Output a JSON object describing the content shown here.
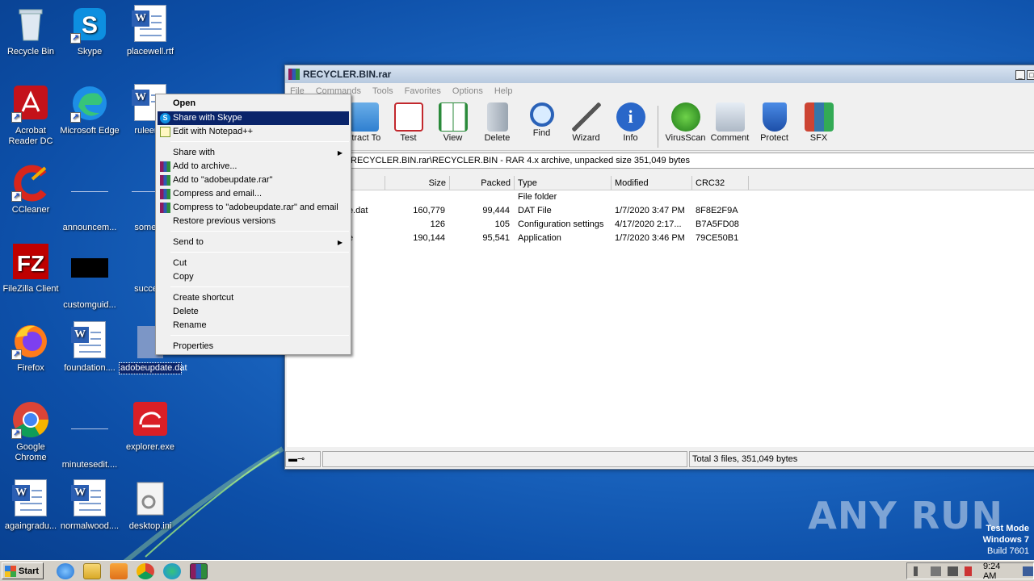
{
  "desktop": {
    "icons": [
      {
        "label": "Recycle Bin",
        "icon": "recycle-bin-icon"
      },
      {
        "label": "Skype",
        "icon": "skype-icon"
      },
      {
        "label": "placewell.rtf",
        "icon": "word-doc-icon"
      },
      {
        "label": "Acrobat Reader DC",
        "icon": "acrobat-icon"
      },
      {
        "label": "Microsoft Edge",
        "icon": "edge-icon"
      },
      {
        "label": "ruleengi",
        "icon": "word-doc-icon"
      },
      {
        "label": "CCleaner",
        "icon": "ccleaner-icon"
      },
      {
        "label": "announcem...",
        "icon": "blank-file-icon"
      },
      {
        "label": "someon",
        "icon": "blank-file-icon"
      },
      {
        "label": "FileZilla Client",
        "icon": "filezilla-icon"
      },
      {
        "label": "customguid...",
        "icon": "black-file-icon"
      },
      {
        "label": "success",
        "icon": "blank-file-icon"
      },
      {
        "label": "Firefox",
        "icon": "firefox-icon"
      },
      {
        "label": "foundation....",
        "icon": "word-doc-icon"
      },
      {
        "label": "adobeupdate.dat",
        "icon": "dat-file-icon"
      },
      {
        "label": "Google Chrome",
        "icon": "chrome-icon"
      },
      {
        "label": "minutesedit....",
        "icon": "blank-file-icon"
      },
      {
        "label": "explorer.exe",
        "icon": "creative-cloud-icon"
      },
      {
        "label": "againgradu...",
        "icon": "word-doc-icon"
      },
      {
        "label": "normalwood....",
        "icon": "word-doc-icon"
      },
      {
        "label": "desktop.ini",
        "icon": "settings-file-icon"
      }
    ]
  },
  "winrar": {
    "title": "RECYCLER.BIN.rar",
    "menu": [
      "File",
      "Commands",
      "Tools",
      "Favorites",
      "Options",
      "Help"
    ],
    "toolbar": [
      "xtract To",
      "Test",
      "View",
      "Delete",
      "Find",
      "Wizard",
      "Info",
      "VirusScan",
      "Comment",
      "Protect",
      "SFX"
    ],
    "path": "RECYCLER.BIN.rar\\RECYCLER.BIN - RAR 4.x archive, unpacked size 351,049 bytes",
    "columns": [
      "Size",
      "Packed",
      "Type",
      "Modified",
      "CRC32"
    ],
    "files": [
      {
        "name": "",
        "size": "",
        "packed": "",
        "type": "File folder",
        "modified": "",
        "crc": ""
      },
      {
        "name": "e.dat",
        "size": "160,779",
        "packed": "99,444",
        "type": "DAT File",
        "modified": "1/7/2020 3:47 PM",
        "crc": "8F8E2F9A"
      },
      {
        "name": "",
        "size": "126",
        "packed": "105",
        "type": "Configuration settings",
        "modified": "4/17/2020 2:17...",
        "crc": "B7A5FD08"
      },
      {
        "name": "e",
        "size": "190,144",
        "packed": "95,541",
        "type": "Application",
        "modified": "1/7/2020 3:46 PM",
        "crc": "79CE50B1"
      }
    ],
    "status": "Total 3 files, 351,049 bytes"
  },
  "context_menu": {
    "items": [
      {
        "label": "Open",
        "bold": true
      },
      {
        "label": "Share with Skype",
        "highlighted": true,
        "icon": "skype-icon"
      },
      {
        "label": "Edit with Notepad++",
        "icon": "notepad-icon"
      },
      {
        "label": "Share with",
        "submenu": true
      },
      {
        "label": "Add to archive...",
        "icon": "winrar-icon"
      },
      {
        "label": "Add to \"adobeupdate.rar\"",
        "icon": "winrar-icon"
      },
      {
        "label": "Compress and email...",
        "icon": "winrar-icon"
      },
      {
        "label": "Compress to \"adobeupdate.rar\" and email",
        "icon": "winrar-icon"
      },
      {
        "label": "Restore previous versions"
      },
      {
        "label": "Send to",
        "submenu": true
      },
      {
        "label": "Cut"
      },
      {
        "label": "Copy"
      },
      {
        "label": "Create shortcut"
      },
      {
        "label": "Delete"
      },
      {
        "label": "Rename"
      },
      {
        "label": "Properties"
      }
    ]
  },
  "taskbar": {
    "start": "Start",
    "clock": "9:24 AM"
  },
  "overlay": {
    "watermark": "ANY RUN",
    "test_mode": "Test Mode",
    "os": "Windows 7",
    "build": "Build 7601"
  }
}
